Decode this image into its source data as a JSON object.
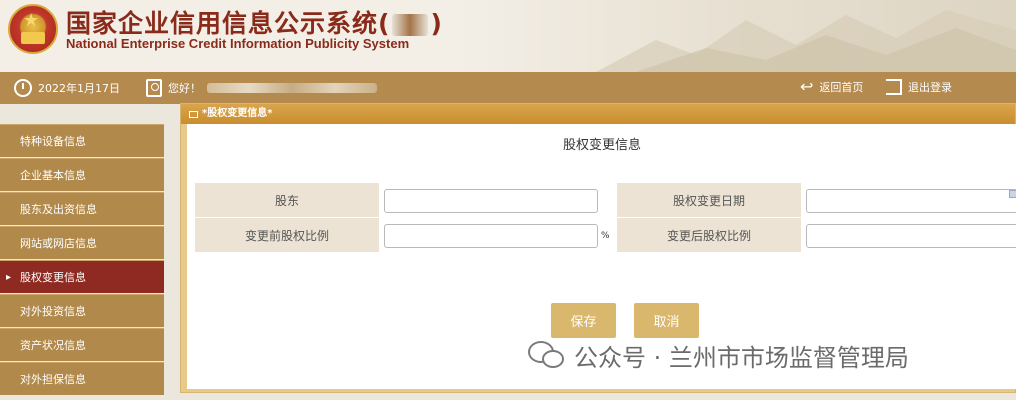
{
  "header": {
    "title_cn_prefix": "国家企业信用信息公示系统(",
    "title_cn_suffix": ")",
    "title_en": "National Enterprise Credit Information Publicity System"
  },
  "infobar": {
    "date": "2022年1月17日",
    "greeting": "您好！",
    "home_link": "返回首页",
    "logout_link": "退出登录"
  },
  "sidebar": {
    "items": [
      {
        "label": "特种设备信息",
        "active": false
      },
      {
        "label": "企业基本信息",
        "active": false
      },
      {
        "label": "股东及出资信息",
        "active": false
      },
      {
        "label": "网站或网店信息",
        "active": false
      },
      {
        "label": "股权变更信息",
        "active": true
      },
      {
        "label": "对外投资信息",
        "active": false
      },
      {
        "label": "资产状况信息",
        "active": false
      },
      {
        "label": "对外担保信息",
        "active": false
      }
    ]
  },
  "dialog": {
    "header_title": "*股权变更信息*",
    "form_title": "股权变更信息",
    "fields": {
      "shareholder_label": "股东",
      "change_date_label": "股权变更日期",
      "before_ratio_label": "变更前股权比例",
      "after_ratio_label": "变更后股权比例",
      "percent_unit": "%"
    },
    "values": {
      "shareholder": "",
      "change_date": "",
      "before_ratio": "",
      "after_ratio": ""
    },
    "buttons": {
      "save": "保存",
      "cancel": "取消"
    }
  },
  "watermark": {
    "text": "公众号 · 兰州市市场监督管理局",
    "icon": "wechat-icon"
  },
  "colors": {
    "brand_red": "#8a2a1a",
    "bar_gold": "#b48a4e",
    "active_item": "#8e2a21",
    "button": "#d9b76d",
    "label_bg": "#ede3d4"
  }
}
